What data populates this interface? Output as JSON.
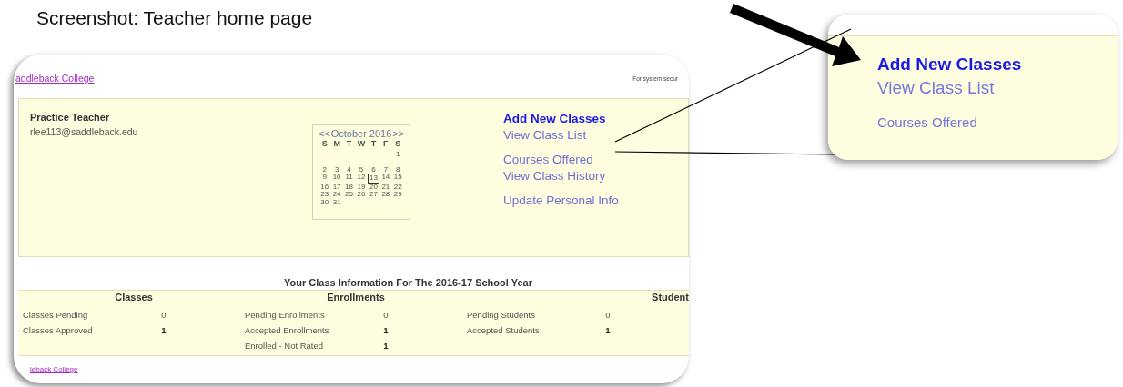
{
  "caption": "Screenshot: Teacher home page",
  "screenshot": {
    "header_link": "addleback College",
    "header_note": "For system secur",
    "teacher": {
      "name": "Practice Teacher",
      "email": "rlee113@saddleback.edu"
    },
    "calendar": {
      "prev": "<<",
      "month": "October 2016",
      "next": ">>",
      "weekdays": [
        "S",
        "M",
        "T",
        "W",
        "T",
        "F",
        "S"
      ],
      "weeks": [
        {
          "days": [
            {
              "label": "1",
              "selected": false
            }
          ]
        },
        {
          "days": [
            {
              "label": "2",
              "selected": false
            },
            {
              "label": "3",
              "selected": false
            },
            {
              "label": "4",
              "selected": false
            },
            {
              "label": "5",
              "selected": false
            },
            {
              "label": "6",
              "selected": false
            },
            {
              "label": "7",
              "selected": false
            },
            {
              "label": "8",
              "selected": false
            }
          ]
        },
        {
          "days": [
            {
              "label": "9",
              "selected": false
            },
            {
              "label": "10",
              "selected": false
            },
            {
              "label": "11",
              "selected": false
            },
            {
              "label": "12",
              "selected": false
            },
            {
              "label": "13",
              "selected": true
            },
            {
              "label": "14",
              "selected": false
            },
            {
              "label": "15",
              "selected": false
            }
          ]
        },
        {
          "days": [
            {
              "label": "16",
              "selected": false
            },
            {
              "label": "17",
              "selected": false
            },
            {
              "label": "18",
              "selected": false
            },
            {
              "label": "19",
              "selected": false
            },
            {
              "label": "20",
              "selected": false
            },
            {
              "label": "21",
              "selected": false
            },
            {
              "label": "22",
              "selected": false
            }
          ]
        },
        {
          "days": [
            {
              "label": "23",
              "selected": false
            },
            {
              "label": "24",
              "selected": false
            },
            {
              "label": "25",
              "selected": false
            },
            {
              "label": "26",
              "selected": false
            },
            {
              "label": "27",
              "selected": false
            },
            {
              "label": "28",
              "selected": false
            },
            {
              "label": "29",
              "selected": false
            }
          ]
        },
        {
          "days": [
            {
              "label": "30",
              "selected": false
            },
            {
              "label": "31",
              "selected": false
            }
          ]
        }
      ]
    },
    "link_groups": [
      [
        {
          "label": "Add New Classes",
          "active": true
        },
        {
          "label": "View Class List",
          "active": false
        }
      ],
      [
        {
          "label": "Courses Offered",
          "active": false
        },
        {
          "label": "View Class History",
          "active": false
        }
      ],
      [
        {
          "label": "Update Personal Info",
          "active": false
        }
      ]
    ],
    "summary_title": "Your Class Information For The 2016-17 School Year",
    "sections": [
      {
        "heading": "Classes",
        "items": [
          {
            "label": "Classes Pending",
            "value": "0",
            "emphasized": false
          },
          {
            "label": "Classes Approved",
            "value": "1",
            "emphasized": true
          }
        ]
      },
      {
        "heading": "Enrollments",
        "items": [
          {
            "label": "Pending Enrollments",
            "value": "0",
            "emphasized": false
          },
          {
            "label": "Accepted Enrollments",
            "value": "1",
            "emphasized": true
          },
          {
            "label": "Enrolled - Not Rated",
            "value": "1",
            "emphasized": true
          }
        ]
      },
      {
        "heading": "Student",
        "items": [
          {
            "label": "Pending Students",
            "value": "0",
            "emphasized": false
          },
          {
            "label": "Accepted Students",
            "value": "1",
            "emphasized": true
          }
        ]
      }
    ],
    "footer_link": "leback College"
  },
  "zoom_inset": {
    "links": [
      {
        "label": "Add New Classes",
        "active": true
      },
      {
        "label": "View Class List",
        "active": false
      },
      {
        "label": "Courses Offered",
        "active": false
      }
    ]
  }
}
